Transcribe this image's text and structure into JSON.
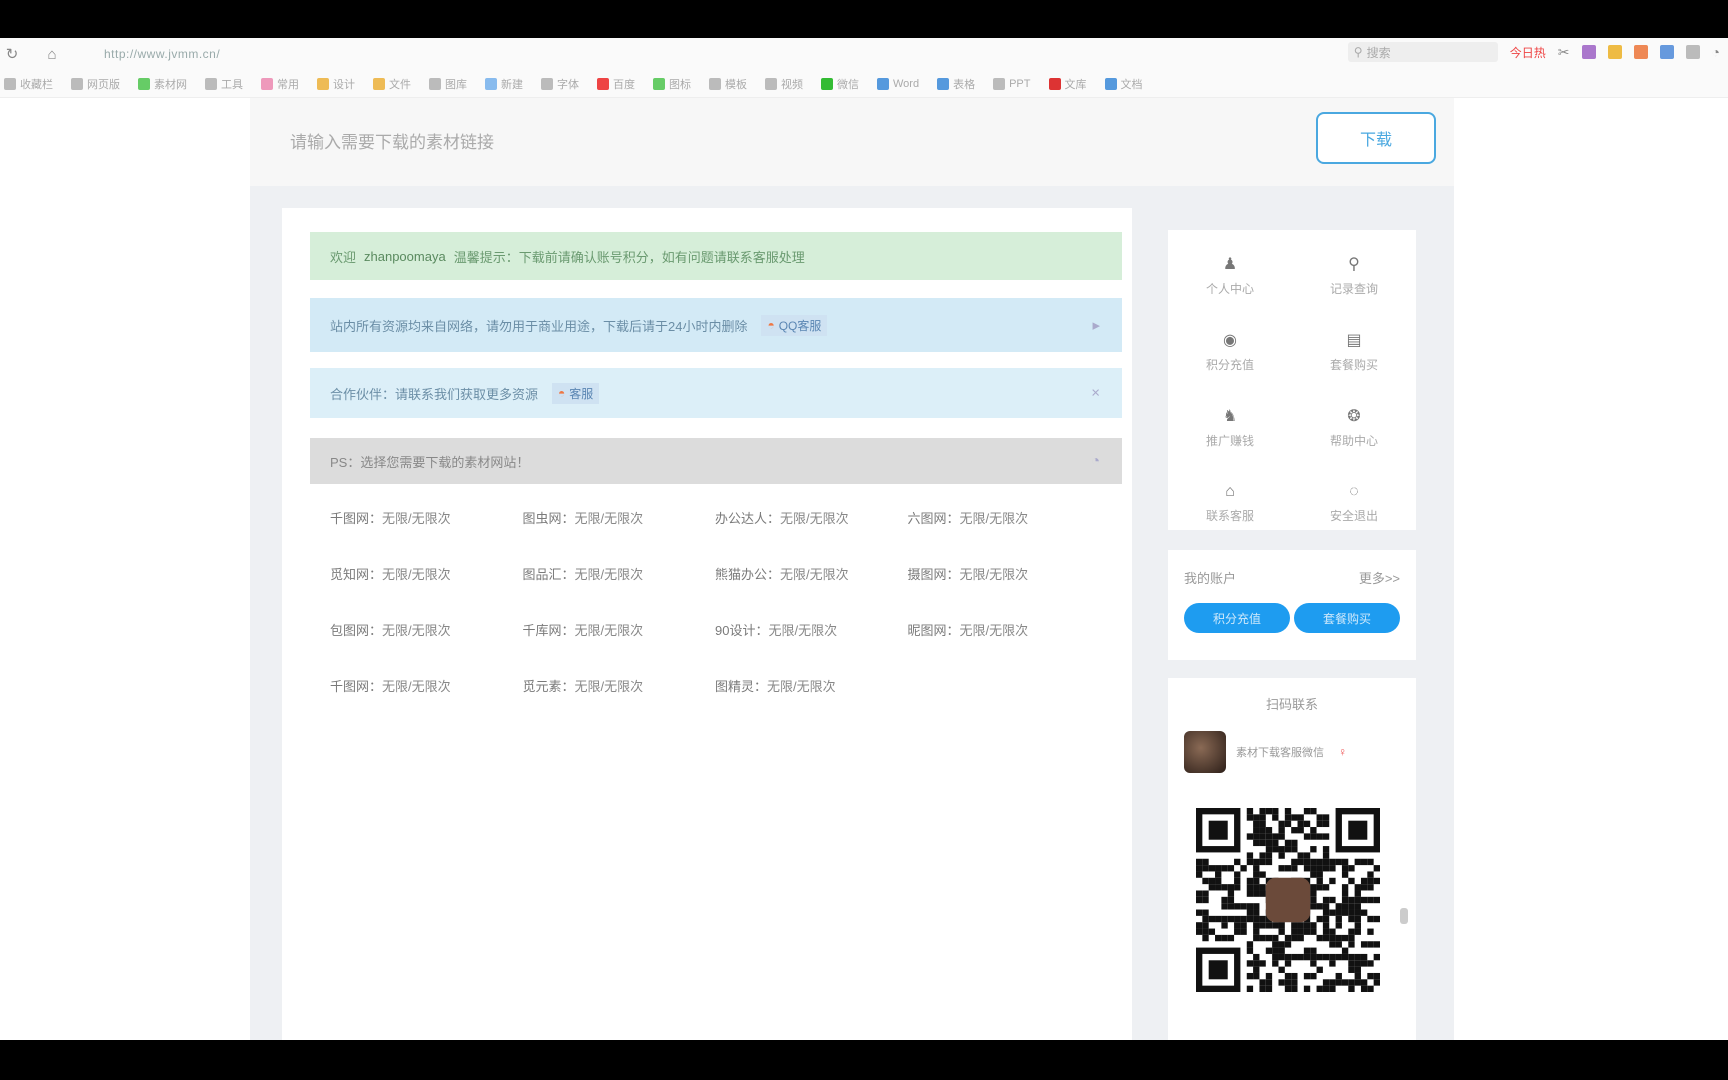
{
  "browser": {
    "url": "http://www.jvmm.cn/",
    "hot_label": "今日热",
    "search_placeholder": "搜索"
  },
  "bookmarks": [
    {
      "label": "收藏栏",
      "color": "#bbb"
    },
    {
      "label": "网页版",
      "color": "#bbb"
    },
    {
      "label": "素材网",
      "color": "#6c6"
    },
    {
      "label": "工具",
      "color": "#bbb"
    },
    {
      "label": "常用",
      "color": "#e9b"
    },
    {
      "label": "设计",
      "color": "#eb5"
    },
    {
      "label": "文件",
      "color": "#eb5"
    },
    {
      "label": "图库",
      "color": "#bbb"
    },
    {
      "label": "新建",
      "color": "#8be"
    },
    {
      "label": "字体",
      "color": "#bbb"
    },
    {
      "label": "百度",
      "color": "#e44"
    },
    {
      "label": "图标",
      "color": "#6c6"
    },
    {
      "label": "模板",
      "color": "#bbb"
    },
    {
      "label": "视频",
      "color": "#bbb"
    },
    {
      "label": "微信",
      "color": "#3b3"
    },
    {
      "label": "Word",
      "color": "#59d"
    },
    {
      "label": "表格",
      "color": "#59d"
    },
    {
      "label": "PPT",
      "color": "#bbb"
    },
    {
      "label": "文库",
      "color": "#d33"
    },
    {
      "label": "文档",
      "color": "#59d"
    }
  ],
  "header": {
    "search_text": "请输入需要下载的素材链接",
    "search_button": "下载"
  },
  "notices": {
    "green_prefix": "欢迎",
    "green_user": "zhanpoomaya",
    "green_text": "温馨提示：下载前请确认账号积分，如有问题请联系客服处理",
    "blue1_text": "站内所有资源均来自网络，请勿用于商业用途，下载后请于24小时内删除",
    "blue1_tag": "QQ客服",
    "blue2_text": "合作伙伴：请联系我们获取更多资源",
    "blue2_tag": "客服",
    "gray_text": "PS：选择您需要下载的素材网站！"
  },
  "sites": [
    {
      "name": "千图网：",
      "status": "无限/无限次"
    },
    {
      "name": "图虫网：",
      "status": "无限/无限次"
    },
    {
      "name": "办公达人：",
      "status": "无限/无限次"
    },
    {
      "name": "六图网：",
      "status": "无限/无限次"
    },
    {
      "name": "觅知网：",
      "status": "无限/无限次"
    },
    {
      "name": "图品汇：",
      "status": "无限/无限次"
    },
    {
      "name": "熊猫办公：",
      "status": "无限/无限次"
    },
    {
      "name": "摄图网：",
      "status": "无限/无限次"
    },
    {
      "name": "包图网：",
      "status": "无限/无限次"
    },
    {
      "name": "千库网：",
      "status": "无限/无限次"
    },
    {
      "name": "90设计：",
      "status": "无限/无限次"
    },
    {
      "name": "昵图网：",
      "status": "无限/无限次"
    },
    {
      "name": "千图网：",
      "status": "无限/无限次"
    },
    {
      "name": "觅元素：",
      "status": "无限/无限次"
    },
    {
      "name": "图精灵：",
      "status": "无限/无限次"
    }
  ],
  "sidebar": {
    "menu": [
      {
        "label": "个人中心",
        "icon": "user-icon",
        "glyph": "♟"
      },
      {
        "label": "记录查询",
        "icon": "search-icon",
        "glyph": "⚲"
      },
      {
        "label": "积分充值",
        "icon": "wallet-icon",
        "glyph": "◉"
      },
      {
        "label": "套餐购买",
        "icon": "layers-icon",
        "glyph": "▤"
      },
      {
        "label": "推广赚钱",
        "icon": "share-icon",
        "glyph": "♞"
      },
      {
        "label": "帮助中心",
        "icon": "gear-icon",
        "glyph": "❂"
      },
      {
        "label": "联系客服",
        "icon": "lock-icon",
        "glyph": "⌂"
      },
      {
        "label": "安全退出",
        "icon": "logout-icon",
        "glyph": "◌"
      }
    ],
    "account_label": "我的账户",
    "account_more": "更多>>",
    "btn_recharge": "积分充值",
    "btn_package": "套餐购买",
    "contact_title": "扫码联系",
    "contact_name": "素材下载客服微信",
    "contact_sex": "♀"
  }
}
